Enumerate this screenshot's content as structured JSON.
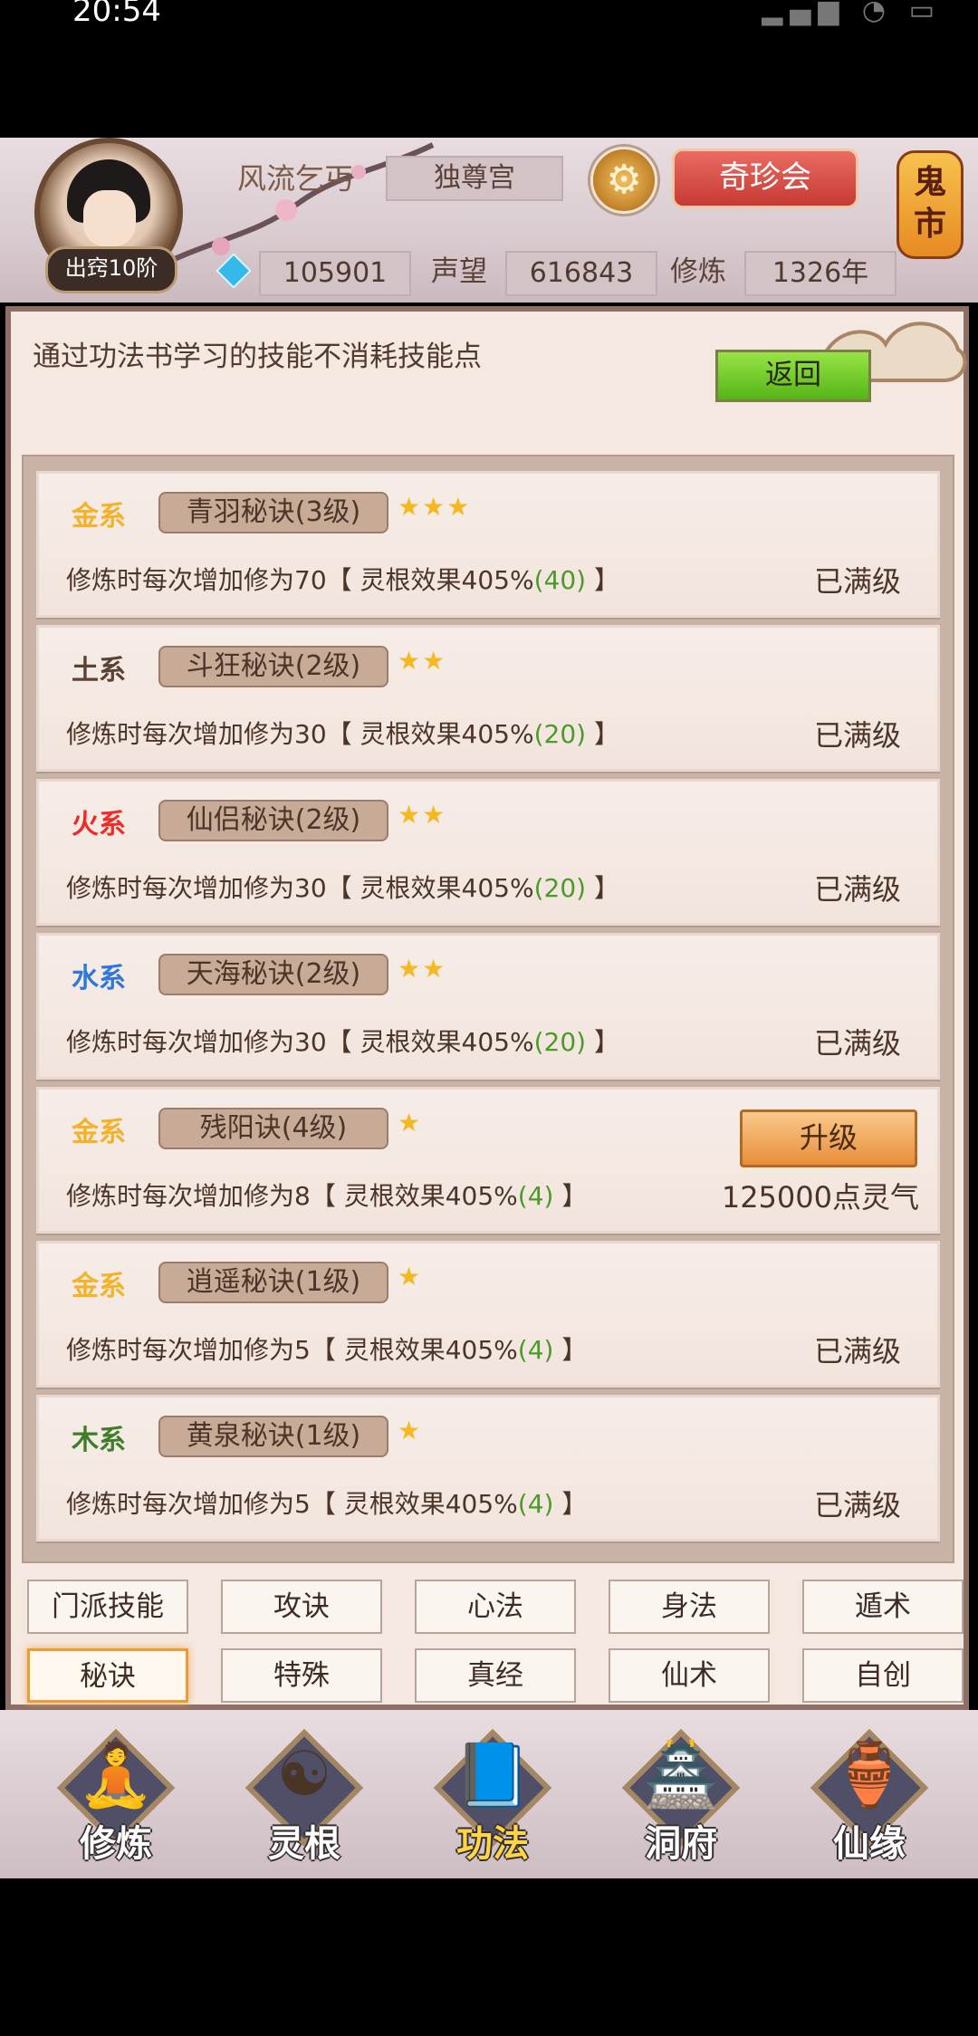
{
  "status_bar": {
    "time": "20:54",
    "icons": [
      "signal-icon",
      "wifi-icon",
      "battery-icon"
    ]
  },
  "header": {
    "player_name": "风流乞丐",
    "sect": "独尊宫",
    "rank": "出窍10阶",
    "spirit_stones": "105901",
    "prestige_label": "声望",
    "prestige_value": "616843",
    "cultivation_label": "修炼",
    "cultivation_value": "1326年",
    "treasure_button": "奇珍会",
    "ghost_market": "鬼市"
  },
  "panel": {
    "tip": "通过功法书学习的技能不消耗技能点",
    "back_button": "返回"
  },
  "skills": [
    {
      "element": "金系",
      "element_color": "#f3b229",
      "name": "青羽秘诀(3级)",
      "stars": "★★★",
      "desc_prefix": "修炼时每次增加修为70【 灵根效果405%",
      "desc_bonus": "(40)",
      "desc_suffix": " 】",
      "status": "已满级"
    },
    {
      "element": "土系",
      "element_color": "#5a4234",
      "name": "斗狂秘诀(2级)",
      "stars": "★★",
      "desc_prefix": "修炼时每次增加修为30【 灵根效果405%",
      "desc_bonus": "(20)",
      "desc_suffix": " 】",
      "status": "已满级"
    },
    {
      "element": "火系",
      "element_color": "#ef2b28",
      "name": "仙侣秘诀(2级)",
      "stars": "★★",
      "desc_prefix": "修炼时每次增加修为30【 灵根效果405%",
      "desc_bonus": "(20)",
      "desc_suffix": " 】",
      "status": "已满级"
    },
    {
      "element": "水系",
      "element_color": "#2f77da",
      "name": "天海秘诀(2级)",
      "stars": "★★",
      "desc_prefix": "修炼时每次增加修为30【 灵根效果405%",
      "desc_bonus": "(20)",
      "desc_suffix": " 】",
      "status": "已满级"
    },
    {
      "element": "金系",
      "element_color": "#f3b229",
      "name": "残阳诀(4级)",
      "stars": "★",
      "desc_prefix": "修炼时每次增加修为8【 灵根效果405%",
      "desc_bonus": "(4)",
      "desc_suffix": " 】",
      "upgrade_button": "升级",
      "cost": "125000点灵气"
    },
    {
      "element": "金系",
      "element_color": "#f3b229",
      "name": "逍遥秘诀(1级)",
      "stars": "★",
      "desc_prefix": "修炼时每次增加修为5【 灵根效果405%",
      "desc_bonus": "(4)",
      "desc_suffix": " 】",
      "status": "已满级"
    },
    {
      "element": "木系",
      "element_color": "#3f7d2a",
      "name": "黄泉秘诀(1级)",
      "stars": "★",
      "desc_prefix": "修炼时每次增加修为5【 灵根效果405%",
      "desc_bonus": "(4)",
      "desc_suffix": " 】",
      "status": "已满级"
    }
  ],
  "tabs_row1": [
    "门派技能",
    "攻诀",
    "心法",
    "身法",
    "遁术"
  ],
  "tabs_row2": [
    "秘诀",
    "特殊",
    "真经",
    "仙术",
    "自创"
  ],
  "active_tab": "秘诀",
  "bottom_nav": [
    {
      "label": "修炼",
      "icon": "meditation-icon",
      "active": false
    },
    {
      "label": "灵根",
      "icon": "spirit-root-icon",
      "active": false
    },
    {
      "label": "功法",
      "icon": "book-icon",
      "active": true
    },
    {
      "label": "洞府",
      "icon": "pavilion-icon",
      "active": false
    },
    {
      "label": "仙缘",
      "icon": "gourd-icon",
      "active": false
    }
  ]
}
